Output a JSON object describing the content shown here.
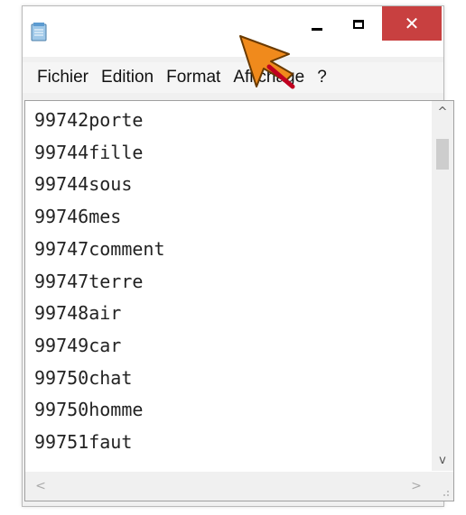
{
  "window": {
    "title": "",
    "icon": "notepad-icon",
    "controls": {
      "minimize": "minimize-icon",
      "maximize": "maximize-icon",
      "close_symbol": "✕",
      "close_color": "#c84040"
    }
  },
  "menu": {
    "items": [
      {
        "label": "Fichier"
      },
      {
        "label": "Edition"
      },
      {
        "label": "Format"
      },
      {
        "label": "Affichage"
      },
      {
        "label": "?"
      }
    ]
  },
  "editor": {
    "lines": [
      "99742porte",
      "99744fille",
      "99744sous",
      "99746mes",
      "99747comment",
      "99747terre",
      "99748air",
      "99749car",
      "99750chat",
      "99750homme",
      "99751faut"
    ],
    "vscroll": {
      "up": "^",
      "down": "v"
    },
    "hscroll": {
      "left": "<",
      "right": ">"
    }
  },
  "overlay": {
    "cursor_icon": "arrow-cursor-icon",
    "cursor_color": "#f08a1c"
  }
}
